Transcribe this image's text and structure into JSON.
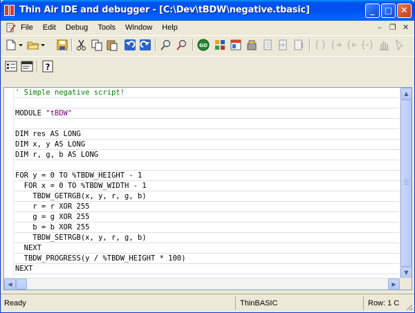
{
  "window": {
    "title": "Thin Air IDE and debugger - [C:\\Dev\\tBDW\\negative.tbasic]",
    "minimize_glyph": "_",
    "maximize_glyph": "□",
    "close_glyph": "✕"
  },
  "menu": {
    "items": [
      "File",
      "Edit",
      "Debug",
      "Tools",
      "Window",
      "Help"
    ],
    "mdi_minimize": "–",
    "mdi_restore": "❐",
    "mdi_close": "✕"
  },
  "editor": {
    "lines": [
      "' Simple negative script!",
      "",
      "MODULE \"tBDW\"",
      "",
      "DIM res AS LONG",
      "DIM x, y AS LONG",
      "DIM r, g, b AS LONG",
      "",
      "FOR y = 0 TO %TBDW_HEIGHT - 1",
      "  FOR x = 0 TO %TBDW_WIDTH - 1",
      "    TBDW_GETRGB(x, y, r, g, b)",
      "    r = r XOR 255",
      "    g = g XOR 255",
      "    b = b XOR 255",
      "    TBDW_SETRGB(x, y, r, g, b)",
      "  NEXT",
      "  TBDW_PROGRESS(y / %TBDW_HEIGHT * 100)",
      "NEXT"
    ],
    "module_keyword": "MODULE ",
    "module_name": "\"tBDW\""
  },
  "status": {
    "state": "Ready",
    "language": "ThinBASIC",
    "position": "Row: 1 C"
  },
  "colors": {
    "comment": "#008000",
    "string": "#800080",
    "titlebar": "#0053ee"
  }
}
